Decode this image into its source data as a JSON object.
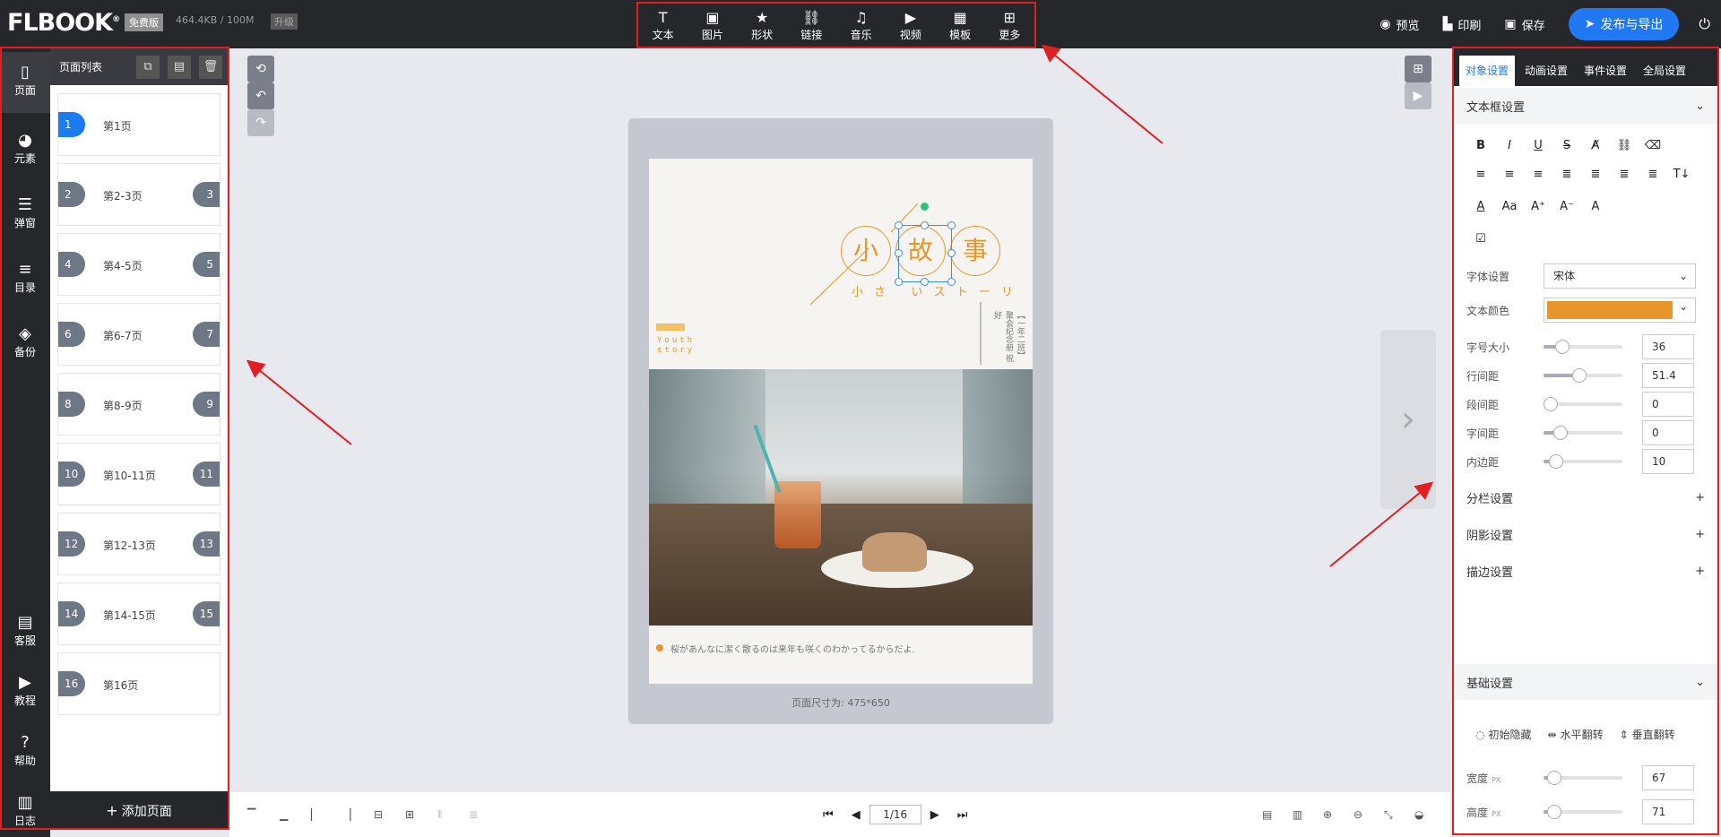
{
  "topbar": {
    "logo": "FLBOOK",
    "badge": "免费版",
    "storage": "464.4KB / 100M",
    "upgrade": "升级",
    "tools": [
      {
        "icon": "text-icon",
        "glyph": "T",
        "label": "文本"
      },
      {
        "icon": "image-icon",
        "glyph": "▣",
        "label": "图片"
      },
      {
        "icon": "shape-icon",
        "glyph": "★",
        "label": "形状"
      },
      {
        "icon": "link-icon",
        "glyph": "⛓",
        "label": "链接"
      },
      {
        "icon": "music-icon",
        "glyph": "♫",
        "label": "音乐"
      },
      {
        "icon": "video-icon",
        "glyph": "▶",
        "label": "视频"
      },
      {
        "icon": "template-icon",
        "glyph": "▦",
        "label": "模板"
      },
      {
        "icon": "more-icon",
        "glyph": "⊞",
        "label": "更多"
      }
    ],
    "preview": "预览",
    "print": "印刷",
    "save": "保存",
    "publish": "发布与导出"
  },
  "leftnav": {
    "items": [
      {
        "label": "页面",
        "glyph": "▯",
        "icon": "page-icon"
      },
      {
        "label": "元素",
        "glyph": "◕",
        "icon": "element-icon"
      },
      {
        "label": "弹窗",
        "glyph": "☰",
        "icon": "popup-icon"
      },
      {
        "label": "目录",
        "glyph": "≡",
        "icon": "catalog-icon"
      },
      {
        "label": "备份",
        "glyph": "◈",
        "icon": "backup-icon"
      }
    ],
    "bottom": [
      {
        "label": "客服",
        "glyph": "▤",
        "icon": "service-icon"
      },
      {
        "label": "教程",
        "glyph": "▶",
        "icon": "tutorial-icon"
      },
      {
        "label": "帮助",
        "glyph": "?",
        "icon": "help-icon"
      },
      {
        "label": "日志",
        "glyph": "▥",
        "icon": "log-icon"
      }
    ]
  },
  "pagepanel": {
    "title": "页面列表",
    "pages": [
      {
        "n1": "1",
        "n2": "",
        "label": "第1页"
      },
      {
        "n1": "2",
        "n2": "3",
        "label": "第2-3页"
      },
      {
        "n1": "4",
        "n2": "5",
        "label": "第4-5页"
      },
      {
        "n1": "6",
        "n2": "7",
        "label": "第6-7页"
      },
      {
        "n1": "8",
        "n2": "9",
        "label": "第8-9页"
      },
      {
        "n1": "10",
        "n2": "11",
        "label": "第10-11页"
      },
      {
        "n1": "12",
        "n2": "13",
        "label": "第12-13页"
      },
      {
        "n1": "14",
        "n2": "15",
        "label": "第14-15页"
      },
      {
        "n1": "16",
        "n2": "",
        "label": "第16页"
      }
    ],
    "add": "添加页面"
  },
  "canvas": {
    "title_chars": [
      "小",
      "故",
      "事"
    ],
    "subtitle": "小 さ   い ス ト ー リ",
    "youth": "Youth\nstory",
    "vertical_text": "【一年二班】 聚会纪念册 祝好",
    "caption": "桜があんなに潔く散るのは来年も咲くのわかってるからだよ.",
    "page_size": "页面尺寸为: 475*650"
  },
  "bottombar": {
    "page_indicator": "1/16"
  },
  "rightpanel": {
    "tabs": [
      "对象设置",
      "动画设置",
      "事件设置",
      "全局设置"
    ],
    "textbox_section": "文本框设置",
    "font_label": "字体设置",
    "font_value": "宋体",
    "color_label": "文本颜色",
    "text_color": "#e8962a",
    "sliders": [
      {
        "label": "字号大小",
        "value": "36",
        "pct": 0.18
      },
      {
        "label": "行间距",
        "value": "51.4",
        "pct": 0.45
      },
      {
        "label": "段间距",
        "value": "0",
        "pct": 0.0
      },
      {
        "label": "字间距",
        "value": "0",
        "pct": 0.15
      },
      {
        "label": "内边距",
        "value": "10",
        "pct": 0.08
      }
    ],
    "column_section": "分栏设置",
    "shadow_section": "阴影设置",
    "stroke_section": "描边设置",
    "basic_section": "基础设置",
    "basic_buttons": [
      "初始隐藏",
      "水平翻转",
      "垂直翻转"
    ],
    "width_label": "宽度",
    "height_label": "高度",
    "unit": "PX",
    "width_value": "67",
    "height_value": "71",
    "width_pct": 0.05,
    "height_pct": 0.05
  },
  "colors": {
    "accent": "#2079f3",
    "highlight": "#e02020",
    "title_orange": "#e8962a"
  }
}
